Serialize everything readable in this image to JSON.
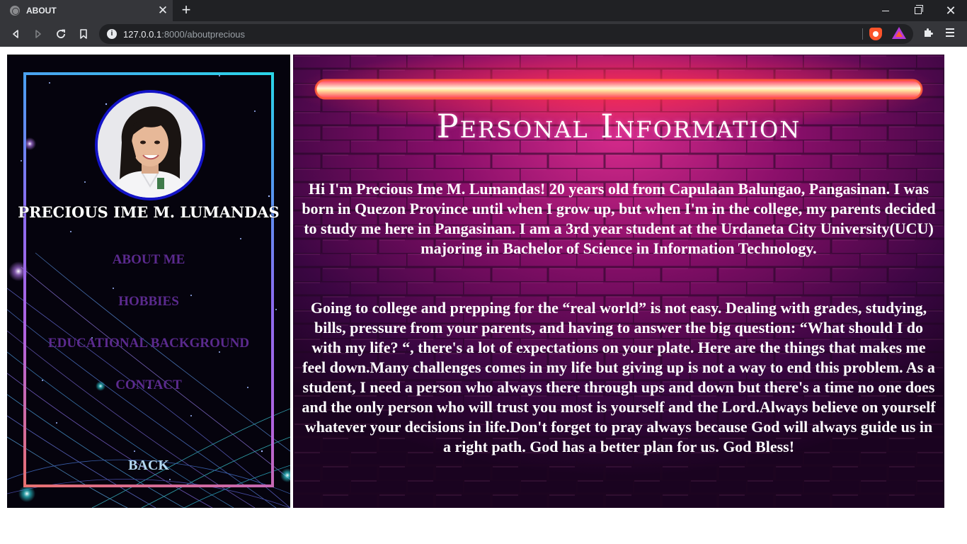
{
  "browser": {
    "tab_title": "ABOUT",
    "tab_close": "✕",
    "new_tab": "+",
    "url_host": "127.0.0.1",
    "url_path": ":8000/aboutprecious",
    "window_close": "✕"
  },
  "sidebar": {
    "name": "PRECIOUS IME M. LUMANDAS",
    "nav": {
      "about": "ABOUT ME",
      "hobbies": "HOBBIES",
      "education": "EDUCATIONAL BACKGROUND",
      "contact": "CONTACT"
    },
    "back": "BACK"
  },
  "main": {
    "title": "Personal Information",
    "paragraph_1": "Hi I'm Precious Ime M. Lumandas! 20 years old from Capulaan Balungao, Pangasinan. I was born in Quezon Province until when I grow up, but when I'm in the college, my parents decided to study me here in Pangasinan. I am a 3rd year student at the Urdaneta City University(UCU) majoring in Bachelor of Science in Information Technology.",
    "paragraph_2": "Going to college and prepping for the “real world” is not easy. Dealing with grades, studying, bills, pressure from your parents, and having to answer the big question: “What should I do with my life? “, there's a lot of expectations on your plate. Here are the things that makes me feel down.Many challenges comes in my life but giving up is not a way to end this problem. As a student, I need a person who always there through ups and down but there's a time no one does and the only person who will trust you most is yourself and the Lord.Always believe on yourself whatever your decisions in life.Don't forget to pray always because God will always guide us in a right path. God has a better plan for us. God Bless!"
  },
  "colors": {
    "nav_link": "#5b2a8e",
    "back_link": "#b4d8f2",
    "avatar_border": "#1414c8",
    "neon": "#ff2d4a"
  }
}
